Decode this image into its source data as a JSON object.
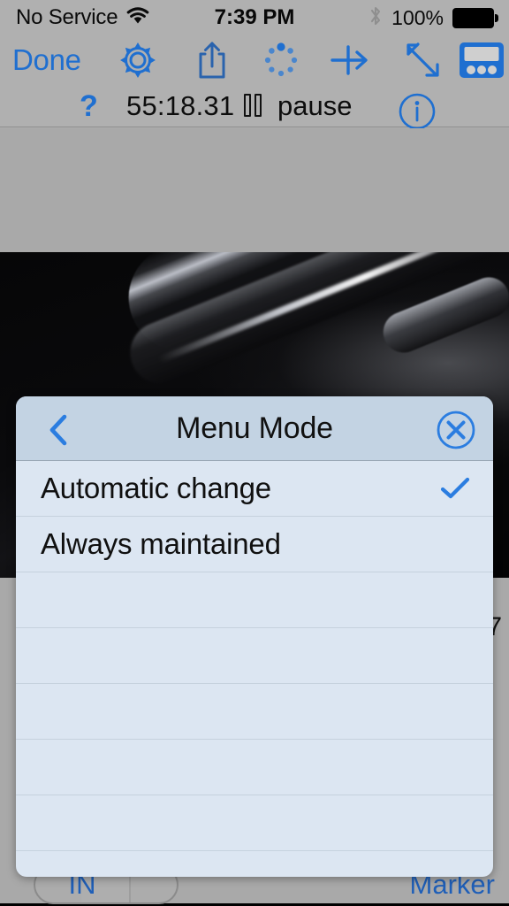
{
  "status_bar": {
    "carrier": "No Service",
    "wifi_icon": "wifi-icon",
    "time": "7:39 PM",
    "bluetooth_icon": "bluetooth-icon",
    "battery_percent": "100%",
    "battery_icon": "battery-full-icon"
  },
  "toolbar": {
    "done_label": "Done",
    "icons": [
      {
        "name": "gear-icon",
        "label": "Settings"
      },
      {
        "name": "share-icon",
        "label": "Share"
      },
      {
        "name": "spinner-dots-icon",
        "label": "Loading"
      },
      {
        "name": "arrow-into-line-icon",
        "label": "Insert"
      },
      {
        "name": "resize-diagonal-icon",
        "label": "Resize"
      },
      {
        "name": "device-panel-icon",
        "label": "Device"
      }
    ]
  },
  "transport": {
    "help_label": "?",
    "timecode": "55:18.31",
    "pause_icon": "pause-icon",
    "pause_label": "pause",
    "info_icon": "info-circle-icon"
  },
  "background": {
    "partial_number": "7"
  },
  "bottom_bar": {
    "segment_label": "IN",
    "marker_label": "Marker"
  },
  "dialog": {
    "back_icon": "chevron-left-icon",
    "title": "Menu Mode",
    "close_icon": "close-circle-icon",
    "check_icon": "checkmark-icon",
    "options": [
      {
        "label": "Automatic change",
        "selected": true
      },
      {
        "label": "Always maintained",
        "selected": false
      }
    ],
    "empty_rows": 6
  },
  "colors": {
    "accent_blue": "#2b7de0",
    "toolbar_blue": "#1f6fd0",
    "bar_grey": "#b0b0b0",
    "dialog_body": "#dce6f2",
    "dialog_header": "#c3d3e3"
  }
}
